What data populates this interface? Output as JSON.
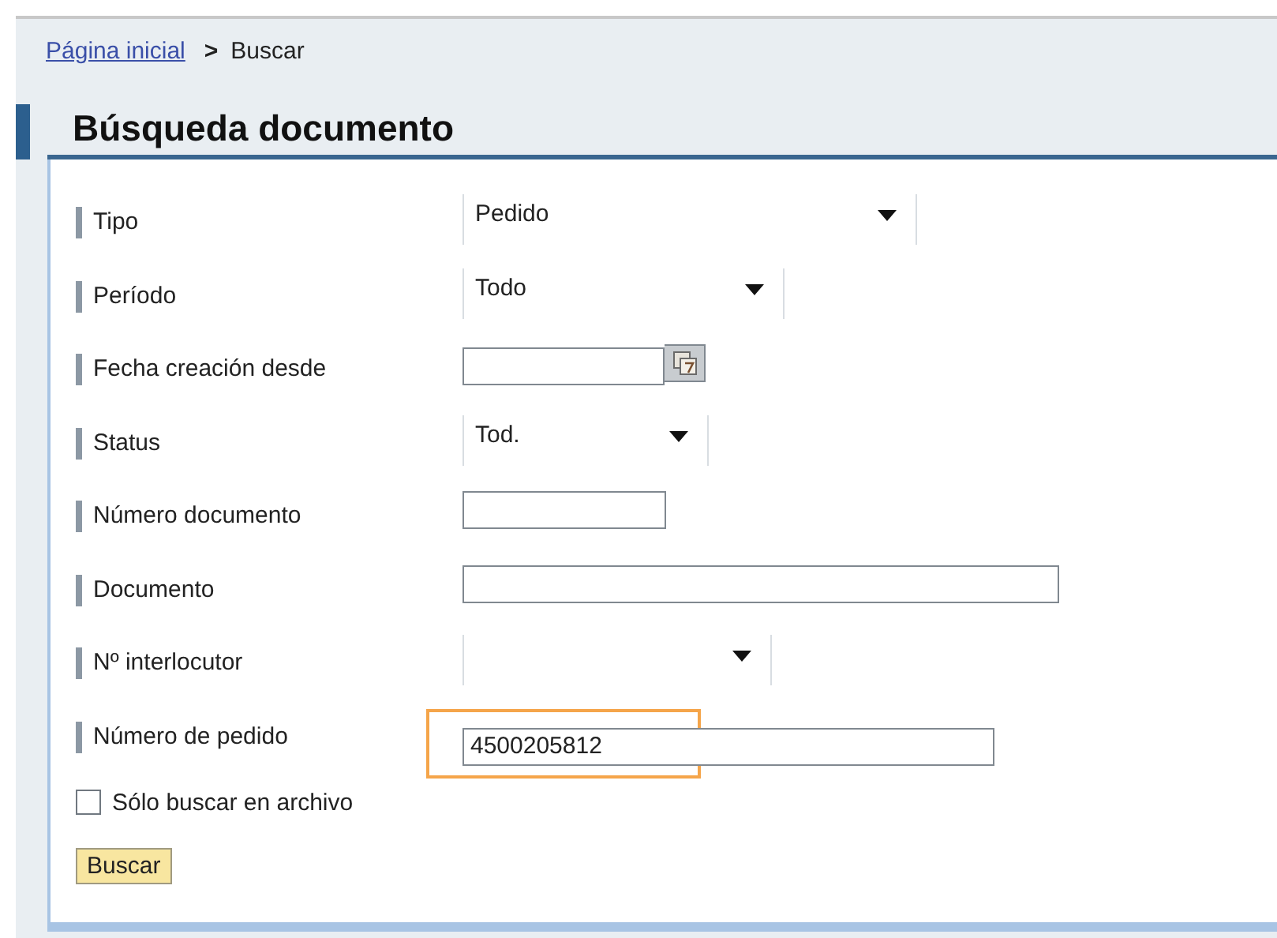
{
  "breadcrumb": {
    "link": "Página inicial",
    "separator": ">",
    "current": "Buscar"
  },
  "title": "Búsqueda documento",
  "fields": [
    {
      "label": "Tipo",
      "kind": "select",
      "value": "Pedido",
      "highlighted": false
    },
    {
      "label": "Período",
      "kind": "select",
      "value": "Todo",
      "highlighted": false
    },
    {
      "label": "Fecha creación desde",
      "kind": "date",
      "highlighted": false
    },
    {
      "label": "Status",
      "kind": "select",
      "value": "Tod.",
      "highlighted": false
    },
    {
      "label": "Número documento",
      "kind": "input",
      "highlighted": false
    },
    {
      "label": "Documento",
      "kind": "input",
      "highlighted": false
    },
    {
      "label": "Nº interlocutor",
      "kind": "select",
      "highlighted": false
    },
    {
      "label": "Número de pedido",
      "kind": "input",
      "value": "4500205812",
      "highlighted": true
    }
  ],
  "archive_checkbox": {
    "label": "Sólo buscar en archivo",
    "checked": false
  },
  "search_button": "Buscar"
}
